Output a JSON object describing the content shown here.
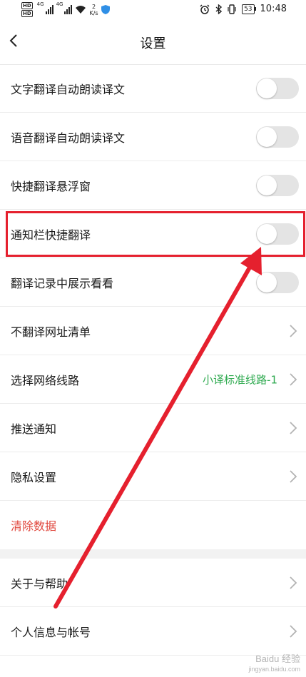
{
  "status_bar": {
    "hd1": "HD",
    "hd2": "HD",
    "net1": "4G",
    "net2": "4G",
    "speed_value": "2",
    "speed_unit": "K/s",
    "battery": "53",
    "time": "10:48"
  },
  "header": {
    "title": "设置"
  },
  "rows": [
    {
      "label": "文字翻译自动朗读译文",
      "type": "toggle",
      "on": false
    },
    {
      "label": "语音翻译自动朗读译文",
      "type": "toggle",
      "on": false
    },
    {
      "label": "快捷翻译悬浮窗",
      "type": "toggle",
      "on": false
    },
    {
      "label": "通知栏快捷翻译",
      "type": "toggle",
      "on": false
    },
    {
      "label": "翻译记录中展示看看",
      "type": "toggle",
      "on": false
    },
    {
      "label": "不翻译网址清单",
      "type": "link"
    },
    {
      "label": "选择网络线路",
      "type": "link",
      "value": "小译标准线路-1"
    },
    {
      "label": "推送通知",
      "type": "link"
    },
    {
      "label": "隐私设置",
      "type": "link"
    },
    {
      "label": "清除数据",
      "type": "action"
    },
    {
      "label": "关于与帮助",
      "type": "link"
    },
    {
      "label": "个人信息与帐号",
      "type": "link"
    }
  ],
  "colors": {
    "accent_green": "#2faa50",
    "danger_red": "#e0463c",
    "annotation_red": "#e5202e",
    "toggle_off": "#e4e4e4"
  },
  "watermark": {
    "brand": "Baidu 经验",
    "url": "jingyan.baidu.com"
  }
}
